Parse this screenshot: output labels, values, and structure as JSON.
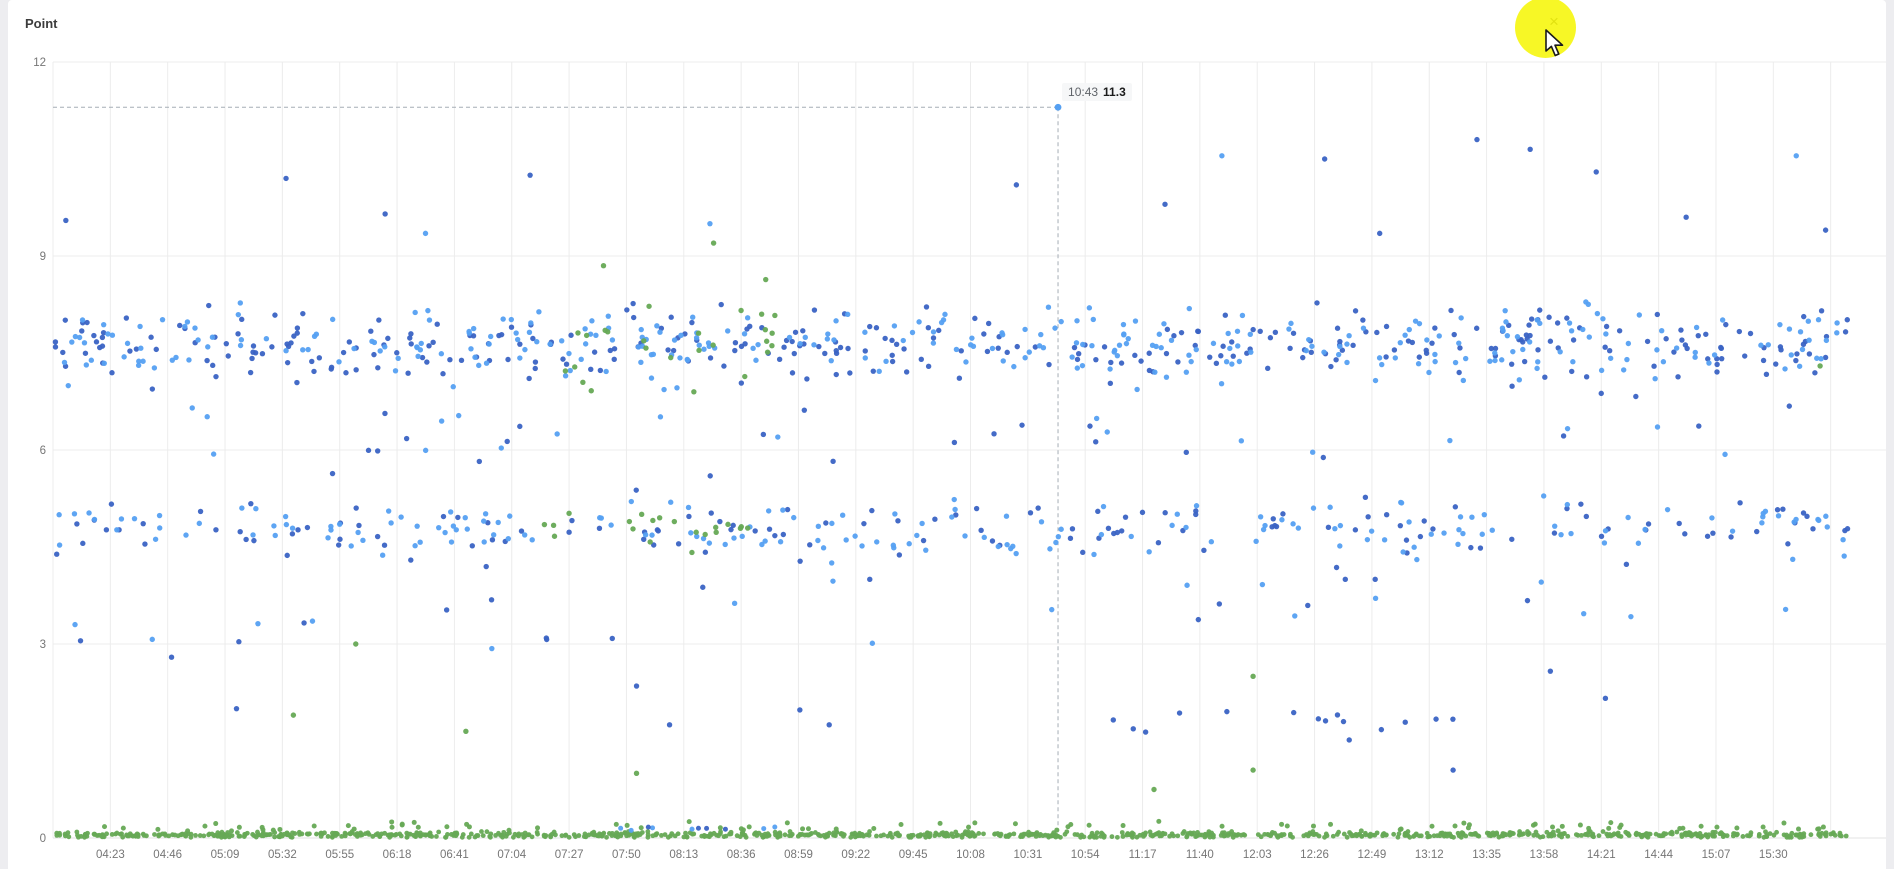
{
  "header": {
    "title": "Point",
    "close_icon": "×"
  },
  "chart_data": {
    "type": "scatter",
    "title": "Point",
    "xlabel": "",
    "ylabel": "",
    "ylim": [
      0,
      12
    ],
    "y_ticks": [
      "0",
      "3",
      "6",
      "9",
      "12"
    ],
    "grid": "on",
    "legend": "none",
    "x_axis": {
      "first_label": "04:23",
      "last_label": "15:30",
      "minutes_per_gridline": 23
    },
    "x_labels": [
      "04:23",
      "04:46",
      "05:09",
      "05:32",
      "05:55",
      "06:18",
      "06:41",
      "07:04",
      "07:27",
      "07:50",
      "08:13",
      "08:36",
      "08:59",
      "09:22",
      "09:45",
      "10:08",
      "10:31",
      "10:54",
      "11:17",
      "11:40",
      "12:03",
      "12:26",
      "12:49",
      "13:12",
      "13:35",
      "13:58",
      "14:21",
      "14:44",
      "15:07",
      "15:30"
    ],
    "series_colors": {
      "dark_blue": "#3a63c4",
      "light_blue": "#55a0f2",
      "green": "#66a955"
    },
    "crosshair": {
      "time": "10:43",
      "value": 11.3,
      "value_label": "11.3",
      "x_frac": 0.5477,
      "dot_series": "light_blue"
    },
    "bands": [
      {
        "name": "upper-band",
        "mix": [
          {
            "s": "dark_blue",
            "n": 330
          },
          {
            "s": "light_blue",
            "n": 310
          }
        ],
        "c": 7.62,
        "sp": 0.42,
        "min": 6.75,
        "max": 8.75,
        "x": [
          0.0,
          0.978
        ],
        "r": 2.7
      },
      {
        "name": "upper-band-green",
        "mix": [
          {
            "s": "green",
            "n": 26
          }
        ],
        "c": 7.8,
        "sp": 0.55,
        "min": 6.9,
        "max": 9.1,
        "x": [
          0.275,
          0.4
        ],
        "r": 2.7
      },
      {
        "name": "middle-band",
        "mix": [
          {
            "s": "dark_blue",
            "n": 135
          },
          {
            "s": "light_blue",
            "n": 175
          }
        ],
        "c": 4.78,
        "sp": 0.33,
        "min": 4.05,
        "max": 5.55,
        "x": [
          0.0,
          0.978
        ],
        "r": 2.7
      },
      {
        "name": "middle-band-green",
        "mix": [
          {
            "s": "green",
            "n": 20
          }
        ],
        "c": 4.8,
        "sp": 0.3,
        "min": 4.2,
        "max": 5.35,
        "x": [
          0.26,
          0.38
        ],
        "r": 2.7
      },
      {
        "name": "between-scatter",
        "mix": [
          {
            "s": "dark_blue",
            "n": 22
          },
          {
            "s": "light_blue",
            "n": 18
          }
        ],
        "c": 6.15,
        "sp": 0.42,
        "min": 5.6,
        "max": 6.85,
        "x": [
          0.0,
          0.978
        ],
        "r": 2.7
      },
      {
        "name": "low-scatter",
        "mix": [
          {
            "s": "dark_blue",
            "n": 16
          },
          {
            "s": "light_blue",
            "n": 16
          }
        ],
        "c": 3.4,
        "sp": 0.65,
        "min": 2.15,
        "max": 4.0,
        "x": [
          0.0,
          0.978
        ],
        "r": 2.7
      },
      {
        "name": "cluster-around-2",
        "mix": [
          {
            "s": "dark_blue",
            "n": 15
          }
        ],
        "c": 1.8,
        "sp": 0.16,
        "min": 1.45,
        "max": 2.05,
        "x": [
          0.575,
          0.765
        ],
        "r": 2.7
      },
      {
        "name": "zero-line-band",
        "mix": [
          {
            "s": "green",
            "n": 980
          }
        ],
        "c": 0.05,
        "sp": 0.035,
        "min": 0.01,
        "max": 0.1,
        "x": [
          0.002,
          0.978
        ],
        "r": 2.4
      },
      {
        "name": "near-zero-green",
        "mix": [
          {
            "s": "green",
            "n": 85
          }
        ],
        "c": 0.17,
        "sp": 0.07,
        "min": 0.11,
        "max": 0.33,
        "x": [
          0.005,
          0.978
        ],
        "r": 2.5
      },
      {
        "name": "near-zero-blue",
        "mix": [
          {
            "s": "light_blue",
            "n": 6
          },
          {
            "s": "dark_blue",
            "n": 4
          }
        ],
        "c": 0.14,
        "sp": 0.05,
        "min": 0.1,
        "max": 0.28,
        "x": [
          0.3,
          0.4
        ],
        "r": 2.5
      }
    ],
    "outliers": [
      {
        "x": 0.007,
        "y": 9.55,
        "s": "dark_blue"
      },
      {
        "x": 0.127,
        "y": 10.2,
        "s": "dark_blue"
      },
      {
        "x": 0.181,
        "y": 9.65,
        "s": "dark_blue"
      },
      {
        "x": 0.203,
        "y": 9.35,
        "s": "light_blue"
      },
      {
        "x": 0.26,
        "y": 10.25,
        "s": "dark_blue"
      },
      {
        "x": 0.358,
        "y": 9.5,
        "s": "light_blue"
      },
      {
        "x": 0.525,
        "y": 10.1,
        "s": "dark_blue"
      },
      {
        "x": 0.606,
        "y": 9.8,
        "s": "dark_blue"
      },
      {
        "x": 0.637,
        "y": 10.55,
        "s": "light_blue"
      },
      {
        "x": 0.693,
        "y": 10.5,
        "s": "dark_blue"
      },
      {
        "x": 0.723,
        "y": 9.35,
        "s": "dark_blue"
      },
      {
        "x": 0.776,
        "y": 10.8,
        "s": "dark_blue"
      },
      {
        "x": 0.805,
        "y": 10.65,
        "s": "dark_blue"
      },
      {
        "x": 0.841,
        "y": 10.3,
        "s": "dark_blue"
      },
      {
        "x": 0.89,
        "y": 9.6,
        "s": "dark_blue"
      },
      {
        "x": 0.95,
        "y": 10.55,
        "s": "light_blue"
      },
      {
        "x": 0.966,
        "y": 9.4,
        "s": "dark_blue"
      },
      {
        "x": 0.3,
        "y": 8.85,
        "s": "green"
      },
      {
        "x": 0.36,
        "y": 9.2,
        "s": "green"
      },
      {
        "x": 0.963,
        "y": 7.3,
        "s": "green"
      },
      {
        "x": 0.131,
        "y": 1.9,
        "s": "green"
      },
      {
        "x": 0.165,
        "y": 3.0,
        "s": "green"
      },
      {
        "x": 0.225,
        "y": 1.65,
        "s": "green"
      },
      {
        "x": 0.318,
        "y": 1.0,
        "s": "green"
      },
      {
        "x": 0.6,
        "y": 0.75,
        "s": "green"
      },
      {
        "x": 0.654,
        "y": 2.5,
        "s": "green"
      },
      {
        "x": 0.654,
        "y": 1.05,
        "s": "green"
      },
      {
        "x": 0.012,
        "y": 3.3,
        "s": "light_blue"
      },
      {
        "x": 0.015,
        "y": 3.05,
        "s": "dark_blue"
      },
      {
        "x": 0.1,
        "y": 2.0,
        "s": "dark_blue"
      },
      {
        "x": 0.318,
        "y": 2.35,
        "s": "dark_blue"
      },
      {
        "x": 0.336,
        "y": 1.75,
        "s": "dark_blue"
      },
      {
        "x": 0.407,
        "y": 1.98,
        "s": "dark_blue"
      },
      {
        "x": 0.423,
        "y": 1.75,
        "s": "dark_blue"
      },
      {
        "x": 0.763,
        "y": 1.05,
        "s": "dark_blue"
      },
      {
        "x": 0.816,
        "y": 2.58,
        "s": "dark_blue"
      },
      {
        "x": 0.846,
        "y": 2.16,
        "s": "dark_blue"
      }
    ]
  }
}
